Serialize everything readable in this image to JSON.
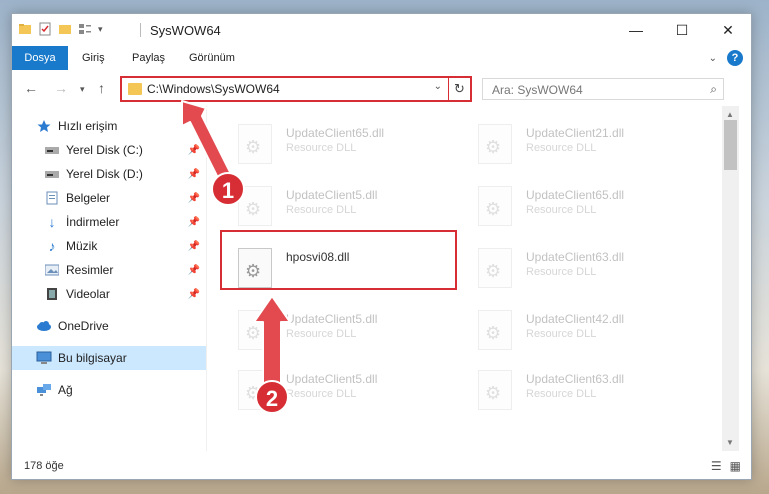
{
  "window": {
    "title": "SysWOW64"
  },
  "ribbon": {
    "tabs": [
      "Dosya",
      "Giriş",
      "Paylaş",
      "Görünüm"
    ]
  },
  "nav": {
    "address": "C:\\Windows\\SysWOW64",
    "search_placeholder": "Ara: SysWOW64"
  },
  "sidebar": {
    "items": [
      {
        "label": "Hızlı erişim",
        "icon": "star-icon"
      },
      {
        "label": "Yerel Disk (C:)",
        "icon": "drive-icon"
      },
      {
        "label": "Yerel Disk (D:)",
        "icon": "drive-icon"
      },
      {
        "label": "Belgeler",
        "icon": "documents-icon"
      },
      {
        "label": "İndirmeler",
        "icon": "download-icon"
      },
      {
        "label": "Müzik",
        "icon": "music-icon"
      },
      {
        "label": "Resimler",
        "icon": "pictures-icon"
      },
      {
        "label": "Videolar",
        "icon": "videos-icon"
      },
      {
        "label": "OneDrive",
        "icon": "cloud-icon"
      },
      {
        "label": "Bu bilgisayar",
        "icon": "computer-icon"
      },
      {
        "label": "Ağ",
        "icon": "network-icon"
      }
    ]
  },
  "files": [
    {
      "name": "UpdateClient65.dll",
      "type": "Resource DLL"
    },
    {
      "name": "UpdateClient21.dll",
      "type": "Resource DLL"
    },
    {
      "name": "UpdateClient5.dll",
      "type": "Resource DLL"
    },
    {
      "name": "UpdateClient65.dll",
      "type": "Resource DLL"
    },
    {
      "name": "hposvi08.dll",
      "type": ""
    },
    {
      "name": "UpdateClient63.dll",
      "type": "Resource DLL"
    },
    {
      "name": "UpdateClient5.dll",
      "type": "Resource DLL"
    },
    {
      "name": "UpdateClient42.dll",
      "type": "Resource DLL"
    },
    {
      "name": "UpdateClient5.dll",
      "type": "Resource DLL"
    },
    {
      "name": "UpdateClient63.dll",
      "type": "Resource DLL"
    }
  ],
  "status": {
    "count": "178 öğe"
  },
  "annotations": {
    "step1": "1",
    "step2": "2"
  },
  "colors": {
    "accent": "#1979ca",
    "highlight": "#d62e34",
    "selected": "#cce8ff"
  }
}
